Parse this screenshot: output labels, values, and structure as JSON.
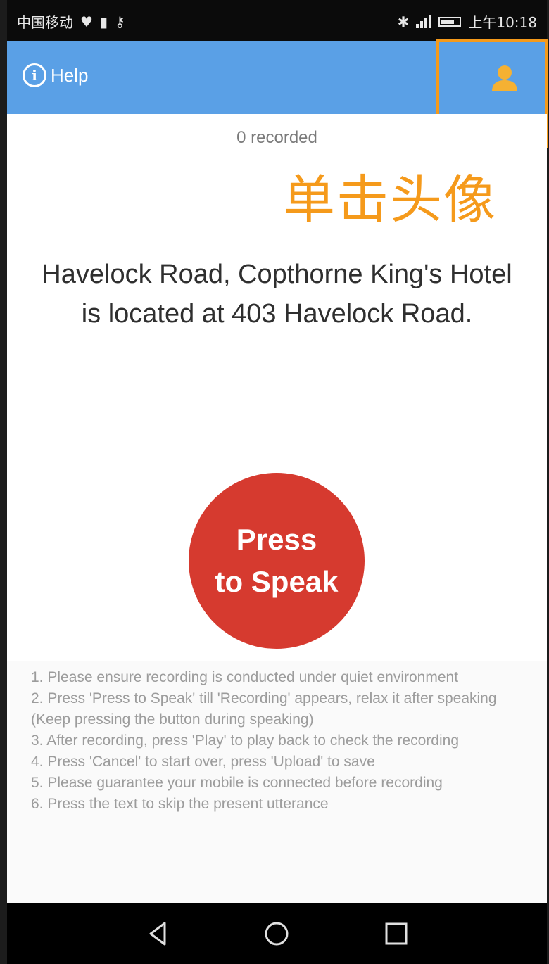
{
  "status_bar": {
    "carrier": "中国移动",
    "time": "上午10:18"
  },
  "header": {
    "help_label": "Help",
    "help_icon": "info-circle-icon",
    "account_icon": "person-icon",
    "accent_color": "#5aa0e6"
  },
  "annotation": {
    "text": "单击头像",
    "color": "#f59a1b"
  },
  "main": {
    "recorded_count": "0 recorded",
    "prompt_text": "Havelock Road,    Copthorne King's Hotel is located at 403 Havelock Road.",
    "speak_button": {
      "line1": "Press",
      "line2": "to Speak",
      "color": "#d63a2f"
    }
  },
  "instructions": [
    "1. Please ensure recording is conducted under quiet environment",
    " 2. Press 'Press to Speak' till 'Recording' appears, relax it after speaking (Keep pressing the button during speaking)",
    " 3. After recording, press 'Play' to play back to check the recording",
    " 4. Press 'Cancel' to start over, press 'Upload' to save",
    " 5. Please guarantee your mobile is connected before recording",
    " 6. Press the text to skip the present utterance"
  ],
  "nav_bar": {
    "back_icon": "back-triangle-icon",
    "home_icon": "home-circle-icon",
    "recents_icon": "recents-square-icon"
  }
}
